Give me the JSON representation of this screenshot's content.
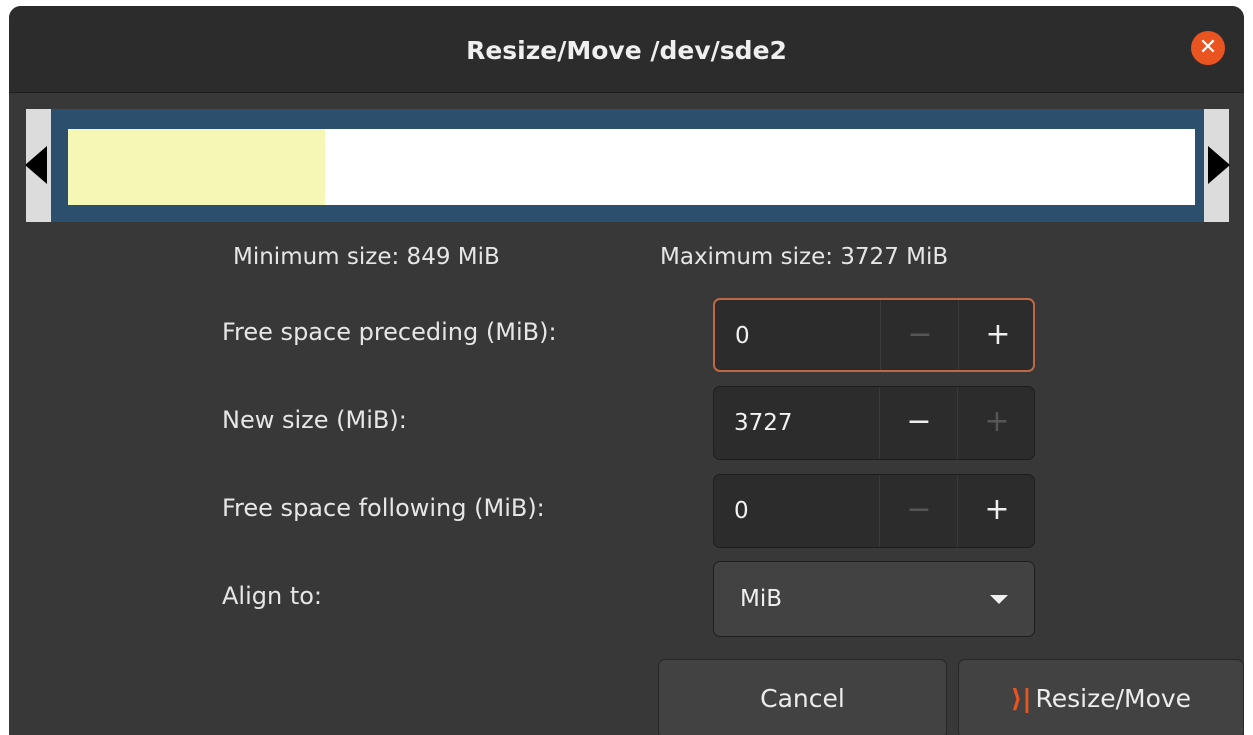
{
  "window": {
    "title": "Resize/Move /dev/sde2"
  },
  "icons": {
    "close": "close-icon",
    "left_handle": "left-arrow-icon",
    "right_handle": "right-arrow-icon",
    "dropdown": "chevron-down-icon",
    "apply": "apply-icon"
  },
  "partition": {
    "used_fraction": 0.228,
    "used_color": "#f7f7b5",
    "border_color": "#2d4f6e"
  },
  "sizes": {
    "minimum": "Minimum size: 849 MiB",
    "maximum": "Maximum size: 3727 MiB"
  },
  "fields": {
    "preceding": {
      "label": "Free space preceding (MiB):",
      "value": "0",
      "minus": "−",
      "plus": "+"
    },
    "new_size": {
      "label": "New size (MiB):",
      "value": "3727",
      "minus": "−",
      "plus": "+"
    },
    "following": {
      "label": "Free space following (MiB):",
      "value": "0",
      "minus": "−",
      "plus": "+"
    },
    "align": {
      "label": "Align to:",
      "value": "MiB"
    }
  },
  "buttons": {
    "cancel": "Cancel",
    "resize_icon": "⟩|",
    "resize": "Resize/Move"
  },
  "colors": {
    "accent": "#e95420",
    "focus_border": "#c06844"
  }
}
